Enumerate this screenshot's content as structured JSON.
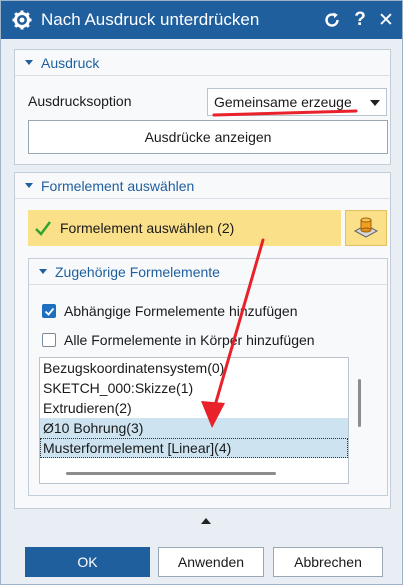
{
  "window": {
    "title": "Nach Ausdruck unterdrücken"
  },
  "ausdruck": {
    "header": "Ausdruck",
    "option_label": "Ausdrucksoption",
    "option_value": "Gemeinsame erzeuge",
    "show_button": "Ausdrücke anzeigen"
  },
  "formelement": {
    "header": "Formelement auswählen",
    "selector_label": "Formelement auswählen (2)",
    "related": {
      "header": "Zugehörige Formelemente",
      "checkbox1": "Abhängige Formelemente hinzufügen",
      "checkbox1_checked": true,
      "checkbox2": "Alle Formelemente in Körper hinzufügen",
      "checkbox2_checked": false,
      "items": [
        "Bezugskoordinatensystem(0)",
        "SKETCH_000:Skizze(1)",
        "Extrudieren(2)",
        "Ø10 Bohrung(3)",
        "Musterformelement [Linear](4)"
      ]
    }
  },
  "footer": {
    "ok": "OK",
    "apply": "Anwenden",
    "cancel": "Abbrechen"
  },
  "colors": {
    "titlebar": "#1f5f9e",
    "selector_bg": "#fbe08a",
    "annotation_red": "#e8212a"
  }
}
